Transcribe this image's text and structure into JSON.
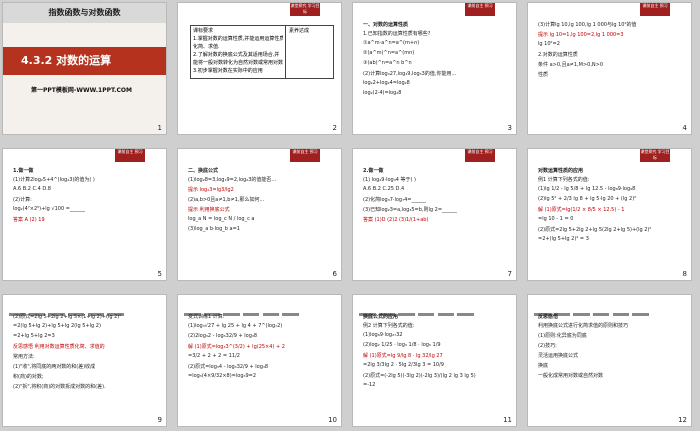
{
  "slides": [
    {
      "n": "1",
      "header": "指数函数与对数函数",
      "title": "4.3.2  对数的运算",
      "footer": "第一PPT模板网-WWW.1PPT.COM"
    },
    {
      "n": "2",
      "badge": "课堂探究\n学习目标",
      "col1": "课标要求",
      "col2": "素养达成",
      "body": [
        "1.掌握对数的运算性质,并能运用运算性质",
        "化简、求值.",
        "2.了解对数的换底公式及其适用场合,并",
        "能将一般对数转化为自然对数或常用对数.",
        "3.初步掌握对数在实际中的应用"
      ]
    },
    {
      "n": "3",
      "badge": "课前自主\n预习",
      "heading": "一、对数的运算性质",
      "body": [
        "1.已知指数的运算性质有哪些?",
        "①a^m·a^n=a^(m+n)",
        "②(a^m)^n=a^(mn)",
        "③(ab)^n=a^n b^n",
        "(2)计算log₃27,log₃9,log₃3的值,你能用...",
        "log₂2+log₂4=log₂8",
        "log₂(2·4)=log₂8"
      ]
    },
    {
      "n": "4",
      "badge": "课前自主\n预习",
      "body": [
        "(3)计算lg 10,lg 100,lg 1 000与lg 10²的值",
        "提示 lg 10=1,lg 100=2,lg 1 000=3",
        "lg 10²=2",
        "2.对数的运算性质",
        "条件  a>0,且a≠1,M>0,N>0",
        "性质"
      ]
    },
    {
      "n": "5",
      "badge": "课前自主\n预习",
      "heading": "1.做一做",
      "body": [
        "(1)计算2log₂5+4^(log₂3)的值为( )",
        "A.6   B.2   C.4   D.8",
        "(2)计算:",
        "log₂(4⁷×2⁵)+lg √100 =______",
        "答案 A  (2) 19"
      ]
    },
    {
      "n": "6",
      "badge": "课前自主\n预习",
      "heading": "二、换底公式",
      "body": [
        "(1)log₂8=3,log₃9=2,log₂3的值能否...",
        "提示 log₂3=lg3/lg2",
        "(2)a,b>0且a≠1,b≠1,那么如何...",
        "提示 利用换底公式",
        "log_a N = log_c N / log_c a",
        "(3)log_a b·log_b a=1"
      ]
    },
    {
      "n": "7",
      "badge": "课前自主\n预习",
      "heading": "2.做一做",
      "body": [
        "(1) log₂9·log₃4 等于( )",
        "A.6   B.2   C.25   D.4",
        "(2)化简log₃7·log₇4=______",
        "(3)已知log₂3=a,log₃5=b,则lg 2=______",
        "答案 (1)D  (2)2  (3)1/(1+ab)"
      ]
    },
    {
      "n": "8",
      "badge": "课堂探究\n学习目标",
      "heading": "对数运算性质的应用",
      "body": [
        "例1 计算下列各式的值:",
        "(1)lg 1/2 - lg 5/8 + lg 12.5 - log₈9·log₉8",
        "(2)lg 5² + 2/3 lg 8 + lg 5·lg 20 + (lg 2)²",
        "解 (1)原式=lg(1/2 × 8/5 × 12.5) - 1",
        "=lg 10 - 1 = 0",
        "(2)原式=2lg 5+2lg 2+lg 5(2lg 2+lg 5)+(lg 2)²",
        "=2+(lg 5+lg 2)² = 3"
      ]
    },
    {
      "n": "9",
      "badge": "",
      "body": [
        "(2)原式=2lg 5+2lg 2+lg 5×(1+lg 2)+(lg 2)²",
        "=2(lg 5+lg 2)+lg 5+lg 2(lg 5+lg 2)",
        "=2+lg 5+lg 2=3",
        "反思感悟 利用对数运算性质化简、求值的",
        "常用方法:",
        "(1)\"收\",将同底的两对数的和(差)收成",
        "积(商)的对数;",
        "(2)\"拆\",将积(商)的对数拆成对数的和(差)."
      ]
    },
    {
      "n": "10",
      "badge": "",
      "body": [
        "变式训练1 计算:",
        "(1)log₃√27 + lg 25 + lg 4 + 7^(log₇2)",
        "(2)2log₃2 - log₃32/9 + log₃8",
        "解 (1)原式=log₃3^(3/2) + lg(25×4) + 2",
        "=3/2 + 2 + 2 = 11/2",
        "(2)原式=log₃4 - log₃32/9 + log₃8",
        "=log₃(4×9/32×8)=log₃9=2"
      ]
    },
    {
      "n": "11",
      "badge": "",
      "heading": "换底公式的应用",
      "body": [
        "例2 计算下列各式的值:",
        "(1)log₈9·log₂₇32",
        "(2)log₂ 1/25 · log₃ 1/8 · log₅ 1/9",
        "解 (1)原式=lg 9/lg 8 · lg 32/lg 27",
        "=2lg 3/3lg 2 · 5lg 2/3lg 3 = 10/9",
        "(2)原式=(-2lg 5)(-3lg 2)(-2lg 3)/(lg 2 lg 3 lg 5)",
        "=-12"
      ]
    },
    {
      "n": "12",
      "badge": "",
      "heading": "反思感悟",
      "body": [
        "利用换底公式进行化简求值的原则和技巧",
        "(1)原则:化异底为同底",
        "(2)技巧:",
        "灵活运用换底公式",
        "换底",
        "一般化成常用对数或自然对数"
      ]
    }
  ]
}
